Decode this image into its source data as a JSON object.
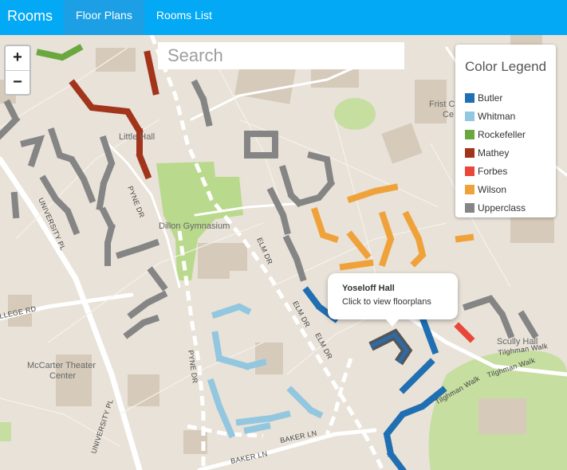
{
  "topbar": {
    "brand": "Rooms",
    "tabs": [
      {
        "label": "Floor Plans",
        "active": true
      },
      {
        "label": "Rooms List",
        "active": false
      }
    ]
  },
  "map": {
    "search": {
      "placeholder": "Search"
    },
    "zoom": {
      "in_label": "+",
      "out_label": "−"
    },
    "legend": {
      "title": "Color Legend",
      "items": [
        {
          "label": "Butler",
          "color": "#1f6fb2"
        },
        {
          "label": "Whitman",
          "color": "#92c7df"
        },
        {
          "label": "Rockefeller",
          "color": "#6aa83f"
        },
        {
          "label": "Mathey",
          "color": "#a3341c"
        },
        {
          "label": "Forbes",
          "color": "#e8473a"
        },
        {
          "label": "Wilson",
          "color": "#f0a23a"
        },
        {
          "label": "Upperclass",
          "color": "#858585"
        }
      ]
    },
    "popup": {
      "title": "Yoseloff Hall",
      "subtitle": "Click to view floorplans"
    },
    "place_labels": {
      "little_hall": "Little Hall",
      "dillon": "Dillon Gymnasium",
      "mccarter": [
        "McCarter Theater",
        "Center"
      ],
      "frist": [
        "Frist C",
        "Ce"
      ],
      "scully": "Scully Hall"
    },
    "road_labels": {
      "pyne_dr_1": "PYNE DR",
      "pyne_dr_2": "PYNE DR",
      "elm_dr_1": "ELM DR",
      "elm_dr_2": "ELM DR",
      "elm_dr_3": "ELM DR",
      "university_pl_1": "UNIVERSITY PL",
      "university_pl_2": "UNIVERSITY PL",
      "college_rd": "LLEGE RD",
      "baker_ln_1": "BAKER LN",
      "baker_ln_2": "BAKER LN",
      "tilghman_1": "Tilghman Walk",
      "tilghman_2": "Tilghman Walk",
      "tilghman_3": "Tilghman Walk"
    }
  }
}
